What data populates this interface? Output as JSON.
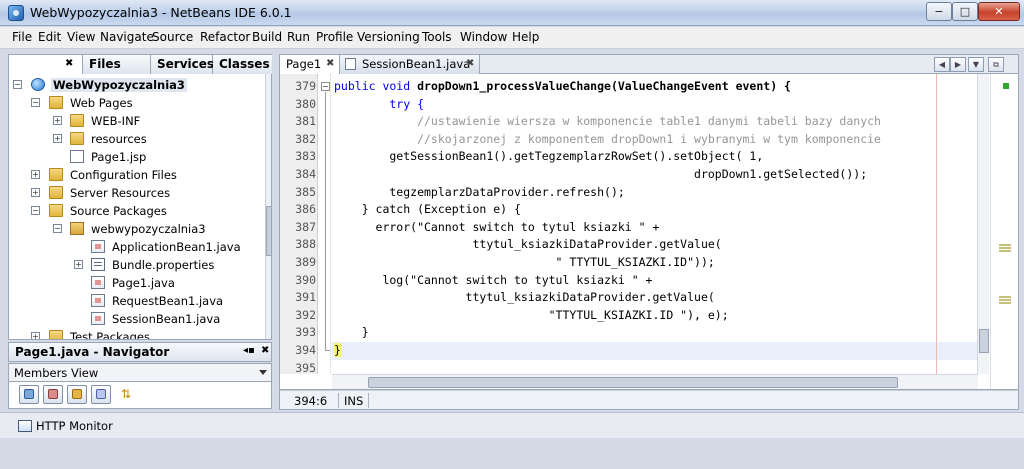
{
  "window": {
    "title": "WebWypozyczalnia3 - NetBeans IDE 6.0.1",
    "minimize": "−",
    "maximize": "□",
    "close": "✕"
  },
  "menu": [
    "File",
    "Edit",
    "View",
    "Navigate",
    "Source",
    "Refactor",
    "Build",
    "Run",
    "Profile",
    "Versioning",
    "Tools",
    "Window",
    "Help"
  ],
  "projects": {
    "tabs": [
      "Files",
      "Services",
      "Classes"
    ],
    "tree": [
      {
        "label": "WebWypozyczalnia3",
        "icon": "globe-icon",
        "bold": true
      },
      {
        "label": "Web Pages",
        "icon": "folder-icon"
      },
      {
        "label": "WEB-INF",
        "icon": "folder-icon"
      },
      {
        "label": "resources",
        "icon": "folder-icon"
      },
      {
        "label": "Page1.jsp",
        "icon": "jsp-file-icon"
      },
      {
        "label": "Configuration Files",
        "icon": "folder-icon"
      },
      {
        "label": "Server Resources",
        "icon": "folder-icon"
      },
      {
        "label": "Source Packages",
        "icon": "folder-icon"
      },
      {
        "label": "webwypozyczalnia3",
        "icon": "package-icon"
      },
      {
        "label": "ApplicationBean1.java",
        "icon": "java-file-icon"
      },
      {
        "label": "Bundle.properties",
        "icon": "properties-file-icon"
      },
      {
        "label": "Page1.java",
        "icon": "java-file-icon"
      },
      {
        "label": "RequestBean1.java",
        "icon": "java-file-icon"
      },
      {
        "label": "SessionBean1.java",
        "icon": "java-file-icon"
      },
      {
        "label": "Test Packages",
        "icon": "folder-icon"
      }
    ]
  },
  "navigator": {
    "title": "Page1.java - Navigator",
    "view": "Members View"
  },
  "editor": {
    "tabs": [
      {
        "label": "Page1",
        "active": true
      },
      {
        "label": "SessionBean1.java",
        "active": false
      }
    ],
    "line_numbers": [
      "379",
      "380",
      "381",
      "382",
      "383",
      "384",
      "385",
      "386",
      "387",
      "388",
      "389",
      "390",
      "391",
      "392",
      "393",
      "394",
      "395"
    ],
    "lines": [
      "public void dropDown1_processValueChange(ValueChangeEvent event) {",
      "        try {",
      "            //ustawienie wiersza w komponencie table1 danymi tabeli bazy danych",
      "            //skojarzonej z komponentem dropDown1 i wybranymi w tym komponencie",
      "        getSessionBean1().getTegzemplarzRowSet().setObject( 1,",
      "                                                    dropDown1.getSelected());",
      "        tegzemplarzDataProvider.refresh();",
      "    } catch (Exception e) {",
      "      error(\"Cannot switch to tytul ksiazki \" +",
      "                    ttytul_ksiazkiDataProvider.getValue(",
      "                                \" TTYTUL_KSIAZKI.ID\"));",
      "       log(\"Cannot switch to tytul ksiazki \" +",
      "                   ttytul_ksiazkiDataProvider.getValue(",
      "                               \"TTYTUL_KSIAZKI.ID \"), e);",
      "    }",
      "}",
      ""
    ]
  },
  "status": {
    "position": "394:6",
    "mode": "INS"
  },
  "bottom": {
    "http_monitor": "HTTP Monitor"
  }
}
